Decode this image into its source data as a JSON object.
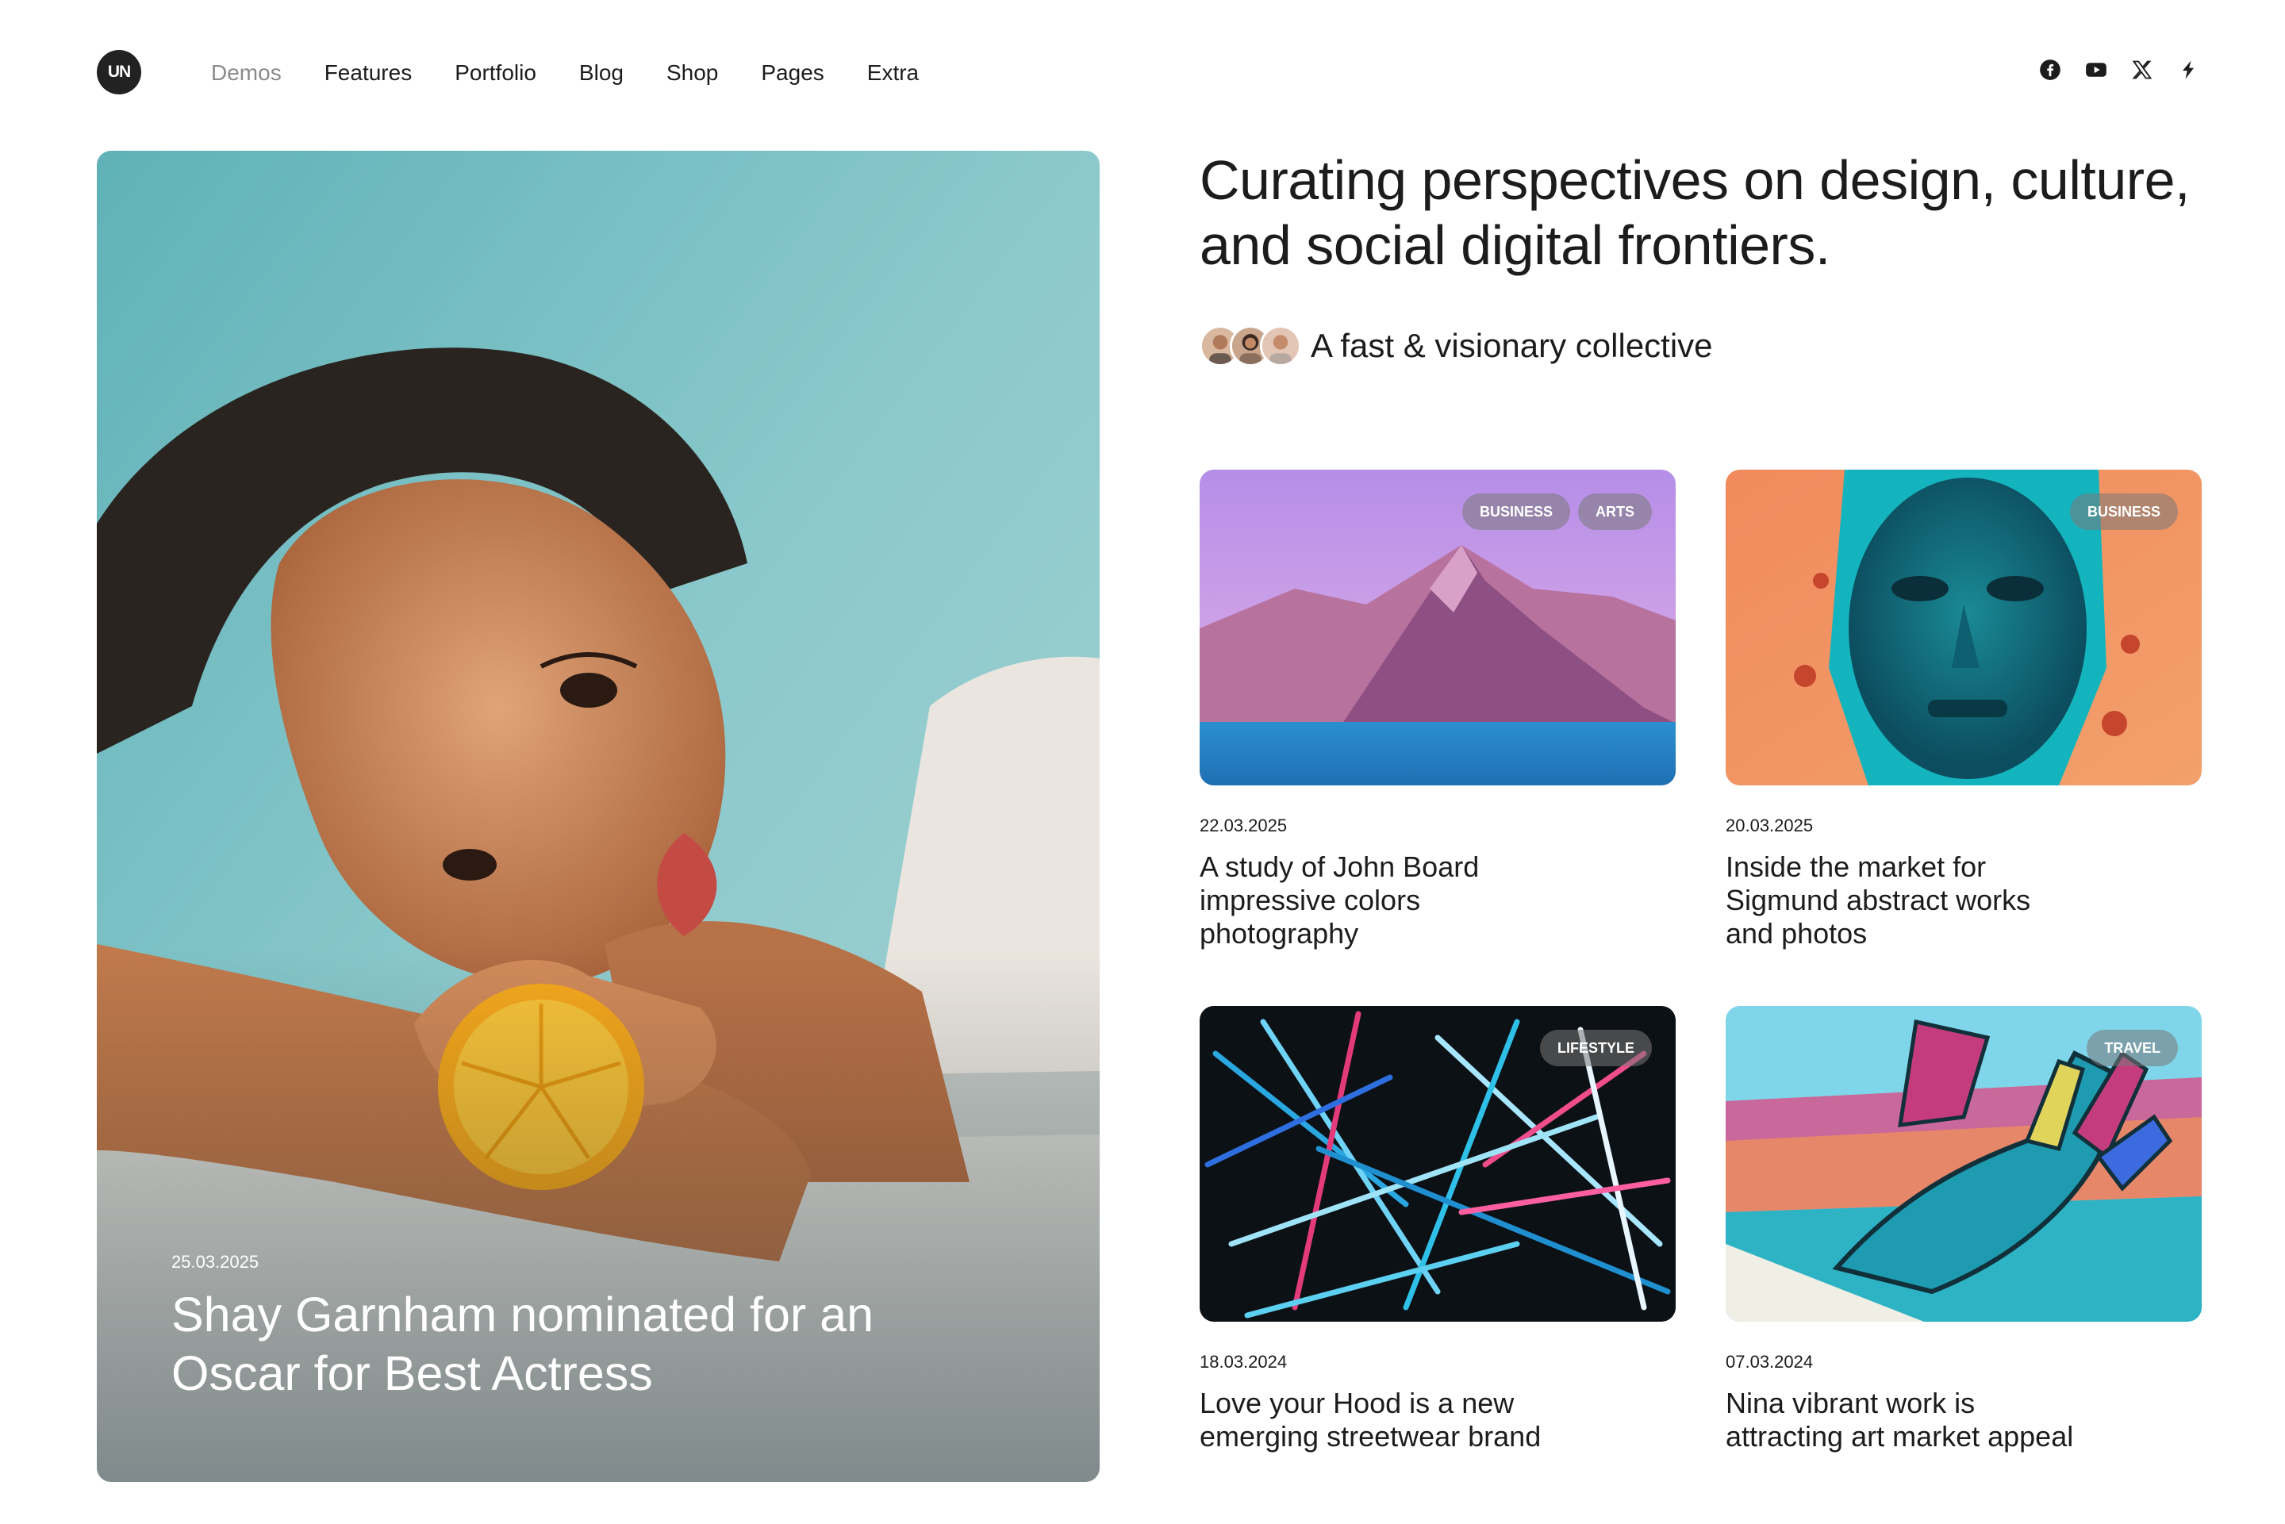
{
  "header": {
    "logo_text": "UN",
    "nav": [
      "Demos",
      "Features",
      "Portfolio",
      "Blog",
      "Shop",
      "Pages",
      "Extra"
    ],
    "social_icons": [
      "facebook-icon",
      "youtube-icon",
      "x-icon",
      "threads-icon"
    ]
  },
  "hero": {
    "date": "25.03.2025",
    "title": "Shay Garnham nominated for an Oscar for Best Actress"
  },
  "intro": {
    "headline": "Curating perspectives on design, culture, and social digital frontiers.",
    "collective": "A fast & visionary collective"
  },
  "posts": [
    {
      "date": "22.03.2025",
      "title": "A study of John Board impressive colors photography",
      "tags": [
        "BUSINESS",
        "ARTS"
      ]
    },
    {
      "date": "20.03.2025",
      "title": "Inside the market for Sigmund abstract works and photos",
      "tags": [
        "BUSINESS"
      ]
    },
    {
      "date": "18.03.2024",
      "title": "Love your Hood is a new emerging streetwear brand",
      "tags": [
        "LIFESTYLE"
      ]
    },
    {
      "date": "07.03.2024",
      "title": "Nina vibrant work is attracting art market appeal",
      "tags": [
        "TRAVEL"
      ]
    }
  ]
}
